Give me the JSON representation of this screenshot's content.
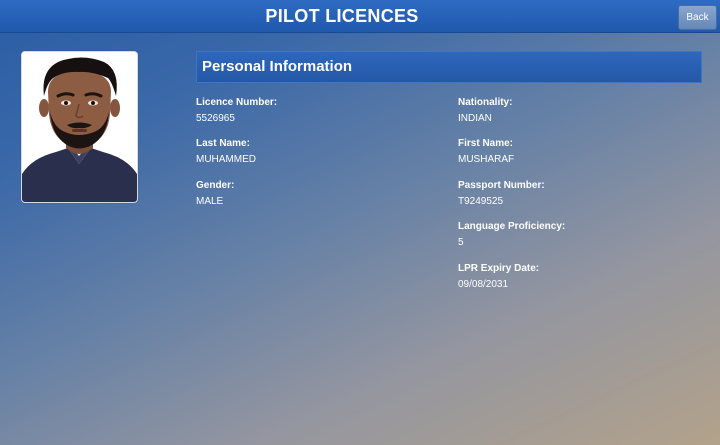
{
  "header": {
    "title": "PILOT LICENCES",
    "back_label": "Back"
  },
  "section": {
    "title": "Personal Information"
  },
  "fields": {
    "licence_number": {
      "label": "Licence Number:",
      "value": "5526965"
    },
    "nationality": {
      "label": "Nationality:",
      "value": "INDIAN"
    },
    "last_name": {
      "label": "Last Name:",
      "value": "MUHAMMED"
    },
    "first_name": {
      "label": "First Name:",
      "value": "MUSHARAF"
    },
    "gender": {
      "label": "Gender:",
      "value": "MALE"
    },
    "passport_number": {
      "label": "Passport Number:",
      "value": "T9249525"
    },
    "language_proficiency": {
      "label": "Language Proficiency:",
      "value": "5"
    },
    "lpr_expiry_date": {
      "label": "LPR Expiry Date:",
      "value": "09/08/2031"
    }
  },
  "colors": {
    "header": "#1f59ad",
    "section_bar": "#2458a8",
    "text": "#ffffff"
  }
}
